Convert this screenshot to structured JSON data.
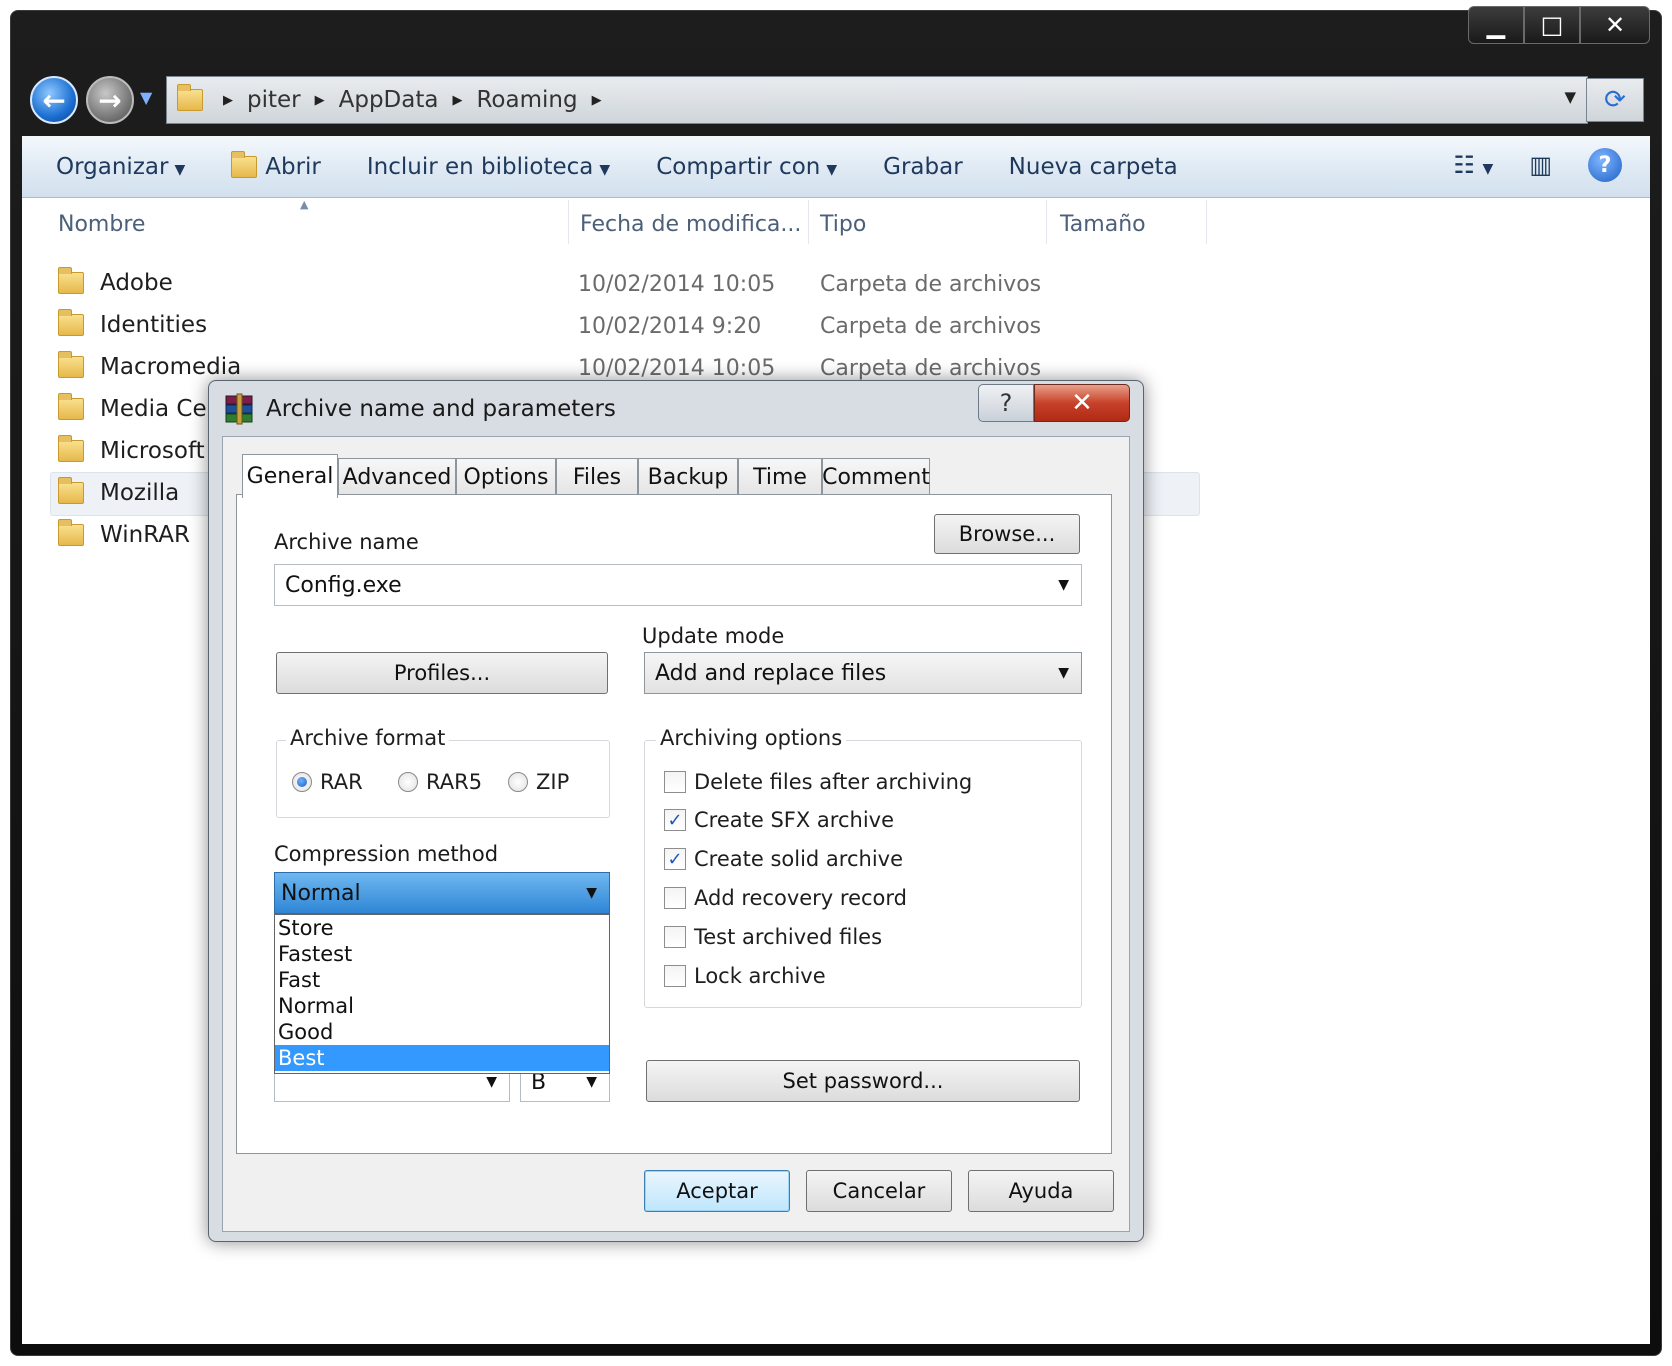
{
  "window": {
    "minimize": "▁",
    "maximize": "□",
    "close": "✕"
  },
  "address": {
    "crumbs": [
      "piter",
      "AppData",
      "Roaming"
    ]
  },
  "toolbar": {
    "organize": "Organizar",
    "open": "Abrir",
    "include_library": "Incluir en biblioteca",
    "share_with": "Compartir con",
    "burn": "Grabar",
    "new_folder": "Nueva carpeta",
    "help": "?"
  },
  "columns": {
    "name": "Nombre",
    "date": "Fecha de modifica...",
    "type": "Tipo",
    "size": "Tamaño"
  },
  "files": [
    {
      "name": "Adobe",
      "date": "10/02/2014 10:05",
      "type": "Carpeta de archivos"
    },
    {
      "name": "Identities",
      "date": "10/02/2014 9:20",
      "type": "Carpeta de archivos"
    },
    {
      "name": "Macromedia",
      "date": "10/02/2014 10:05",
      "type": "Carpeta de archivos"
    },
    {
      "name": "Media Cer",
      "date": "",
      "type": ""
    },
    {
      "name": "Microsoft",
      "date": "",
      "type": ""
    },
    {
      "name": "Mozilla",
      "date": "",
      "type": ""
    },
    {
      "name": "WinRAR",
      "date": "",
      "type": ""
    }
  ],
  "dialog": {
    "title": "Archive name and parameters",
    "help_button": "?",
    "close_button": "✕",
    "tabs": [
      "General",
      "Advanced",
      "Options",
      "Files",
      "Backup",
      "Time",
      "Comment"
    ],
    "archive_name_label": "Archive name",
    "browse_button": "Browse...",
    "archive_name_value": "Config.exe",
    "profiles_button": "Profiles...",
    "update_mode_label": "Update mode",
    "update_mode_value": "Add and replace files",
    "archive_format_label": "Archive format",
    "formats": [
      "RAR",
      "RAR5",
      "ZIP"
    ],
    "selected_format": "RAR",
    "compression_label": "Compression method",
    "compression_value": "Normal",
    "compression_options": [
      "Store",
      "Fastest",
      "Fast",
      "Normal",
      "Good",
      "Best"
    ],
    "compression_highlighted": "Best",
    "split_unit_value": "B",
    "archiving_options_label": "Archiving options",
    "options": [
      {
        "label": "Delete files after archiving",
        "checked": false
      },
      {
        "label": "Create SFX archive",
        "checked": true
      },
      {
        "label": "Create solid archive",
        "checked": true
      },
      {
        "label": "Add recovery record",
        "checked": false
      },
      {
        "label": "Test archived files",
        "checked": false
      },
      {
        "label": "Lock archive",
        "checked": false
      }
    ],
    "set_password_button": "Set password...",
    "ok_button": "Aceptar",
    "cancel_button": "Cancelar",
    "help_footer_button": "Ayuda"
  },
  "colors": {
    "selection": "#3399ff",
    "toolbar_text": "#1e395b",
    "close_red": "#c8412a"
  }
}
